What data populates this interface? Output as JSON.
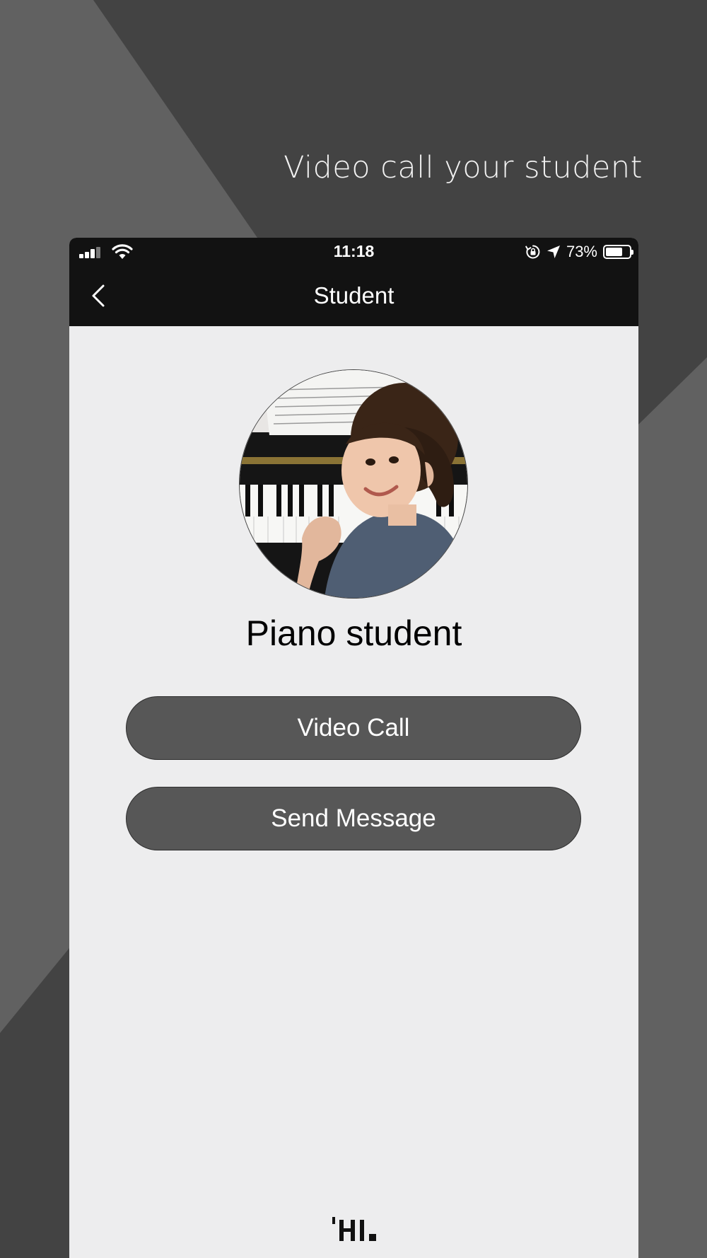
{
  "promo": {
    "caption": "Video call your student"
  },
  "status_bar": {
    "time": "11:18",
    "battery_percent_text": "73%",
    "battery_level": 0.73,
    "icons": [
      "signal-icon",
      "wifi-icon",
      "rotation-lock-icon",
      "location-arrow-icon",
      "battery-icon"
    ]
  },
  "nav": {
    "title": "Student",
    "back_icon": "chevron-left-icon"
  },
  "profile": {
    "name": "Piano student",
    "avatar": "girl-at-piano-photo"
  },
  "actions": {
    "video_call_label": "Video Call",
    "send_message_label": "Send Message"
  },
  "footer": {
    "logo": "'HI."
  },
  "colors": {
    "background_dark": "#434343",
    "background_mid": "#616161",
    "bar": "#121212",
    "screen": "#ededee",
    "button": "#575757"
  }
}
